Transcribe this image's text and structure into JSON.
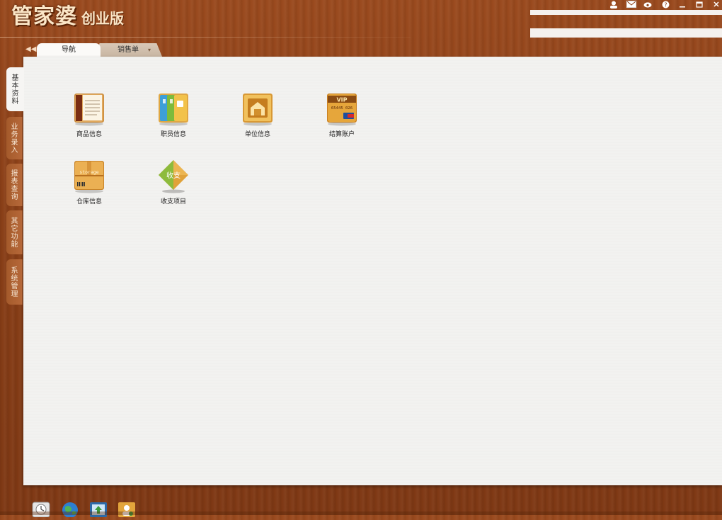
{
  "app": {
    "title_main": "管家婆",
    "title_edition": "创业版"
  },
  "window_controls": [
    "user-icon",
    "mail-icon",
    "weibo-icon",
    "help-icon",
    "minimize-icon",
    "restore-icon",
    "close-icon"
  ],
  "tabs": [
    {
      "label": "导航",
      "active": true
    },
    {
      "label": "销售单",
      "active": false
    }
  ],
  "side_tabs": [
    {
      "chars": [
        "基",
        "本",
        "资",
        "料"
      ],
      "active": true
    },
    {
      "chars": [
        "业",
        "务",
        "录",
        "入"
      ],
      "active": false
    },
    {
      "chars": [
        "报",
        "表",
        "查",
        "询"
      ],
      "active": false
    },
    {
      "chars": [
        "其",
        "它",
        "功",
        "能"
      ],
      "active": false
    },
    {
      "chars": [
        "系",
        "统",
        "管",
        "理"
      ],
      "active": false
    }
  ],
  "tiles": [
    {
      "label": "商品信息",
      "icon": "product-book-icon"
    },
    {
      "label": "职员信息",
      "icon": "staff-cards-icon"
    },
    {
      "label": "单位信息",
      "icon": "warehouse-door-icon"
    },
    {
      "label": "结算账户",
      "icon": "vip-card-icon",
      "card_title": "VIP",
      "card_number": "65445 026"
    },
    {
      "label": "仓库信息",
      "icon": "storage-box-icon",
      "box_text": "storage"
    },
    {
      "label": "收支项目",
      "icon": "income-expense-diamond-icon",
      "diamond_text": "收支"
    }
  ],
  "taskbar": [
    "clock-icon",
    "globe-icon",
    "update-icon",
    "user-manage-icon"
  ],
  "colors": {
    "wood": "#8a3f17",
    "panel": "#f3f2f0",
    "logo_text": "#fbe6c7"
  }
}
